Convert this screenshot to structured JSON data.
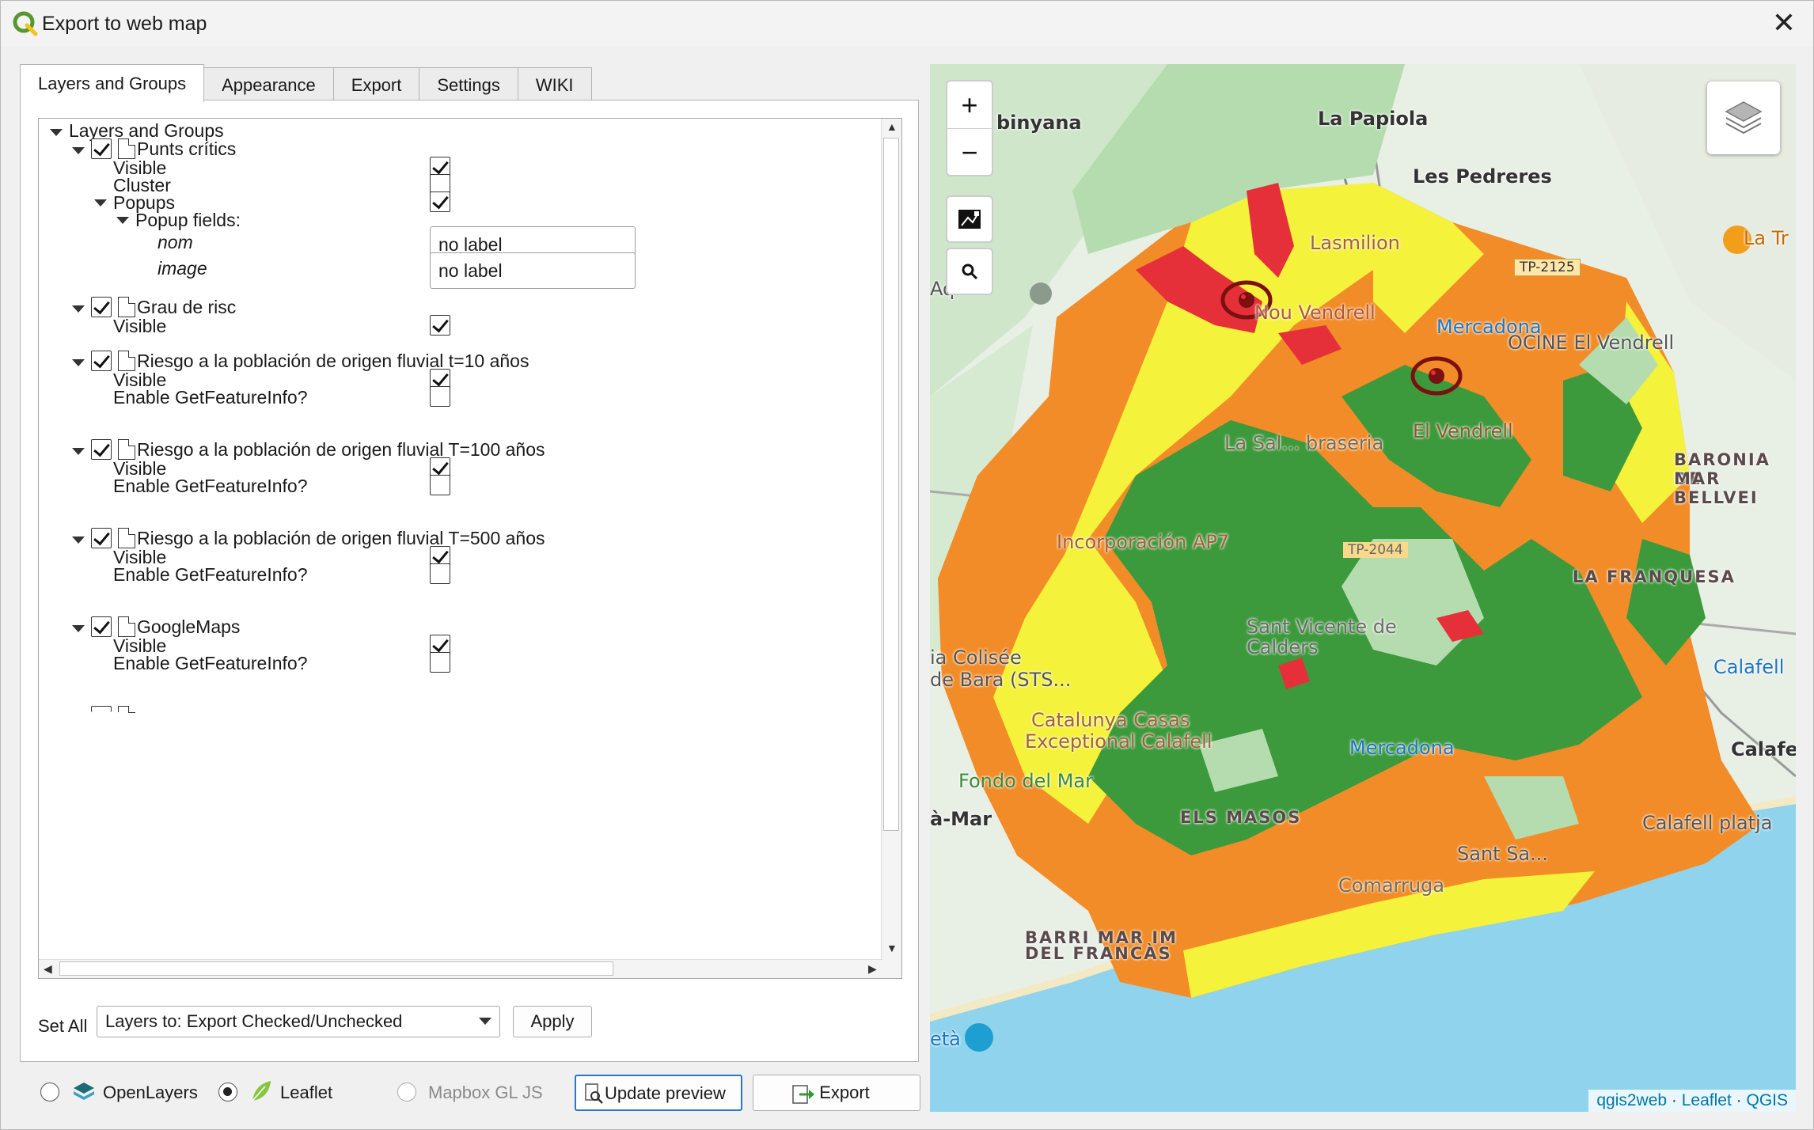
{
  "window": {
    "title": "Export to web map",
    "close_label": "✕"
  },
  "tabs": [
    {
      "label": "Layers and Groups",
      "active": true
    },
    {
      "label": "Appearance"
    },
    {
      "label": "Export"
    },
    {
      "label": "Settings"
    },
    {
      "label": "WIKI"
    }
  ],
  "tree": {
    "root": "Layers and Groups",
    "layers": [
      {
        "name": "Punts crítics",
        "checked": true,
        "visible_label": "Visible",
        "visible": true,
        "cluster_label": "Cluster",
        "cluster": false,
        "popups_label": "Popups",
        "popups": true,
        "popup_fields_label": "Popup fields:",
        "fields": [
          {
            "name": "nom",
            "value": "no label"
          },
          {
            "name": "image",
            "value": "no label"
          }
        ]
      },
      {
        "name": "Grau de risc",
        "checked": true,
        "visible_label": "Visible",
        "visible": true
      },
      {
        "name": "Riesgo a la población de origen fluvial t=10 años",
        "checked": true,
        "visible_label": "Visible",
        "visible": true,
        "gfi_label": "Enable GetFeatureInfo?",
        "gfi": false
      },
      {
        "name": "Riesgo a la población de origen fluvial T=100 años",
        "checked": true,
        "visible_label": "Visible",
        "visible": true,
        "gfi_label": "Enable GetFeatureInfo?",
        "gfi": false
      },
      {
        "name": "Riesgo a la población de origen fluvial T=500 años",
        "checked": true,
        "visible_label": "Visible",
        "visible": true,
        "gfi_label": "Enable GetFeatureInfo?",
        "gfi": false
      },
      {
        "name": "GoogleMaps",
        "checked": true,
        "visible_label": "Visible",
        "visible": true,
        "gfi_label": "Enable GetFeatureInfo?",
        "gfi": false
      }
    ]
  },
  "set_all": {
    "label": "Set All",
    "combo_value": "Layers to: Export Checked/Unchecked",
    "apply_label": "Apply"
  },
  "bottom": {
    "openlayers_label": "OpenLayers",
    "leaflet_label": "Leaflet",
    "mapbox_label": "Mapbox GL JS",
    "selected": "Leaflet",
    "update_preview_label": "Update preview",
    "export_label": "Export"
  },
  "map": {
    "zoom_in": "+",
    "zoom_out": "−",
    "attribution": {
      "qgis2web": "qgis2web",
      "sep": " · ",
      "leaflet": "Leaflet",
      "qgis": "QGIS"
    },
    "labels": [
      "binyana",
      "La Papiola",
      "Les Pedreres",
      "La Tr",
      "Aq",
      "Nou Vendrell",
      "Mercadona",
      "OCINE El Vendrell",
      "El Vendrell",
      "La Sal... braseria",
      "BARONIA DE",
      "MAR BELLVEI",
      "Incorporación AP7",
      "LA FRANQUESA",
      "Sant Vicente de Calders",
      "Calafell",
      "ia Colisée",
      "de Bara (STS...",
      "Catalunya Casas",
      "Exceptional Calafell",
      "Mercadona",
      "Calafe",
      "Fondo del Mar",
      "à-Mar",
      "ELS MASOS",
      "Sant Sa...",
      "Comarruga",
      "BARRI MAR IM",
      "DEL FRANCÀS",
      "Calafell platja",
      "età",
      "Lasmilion",
      "TP-2125",
      "TP-2044"
    ],
    "colors": {
      "high": "#e5303a",
      "medium_high": "#f28c28",
      "medium": "#f4f23a",
      "low": "#3c9a3c",
      "very_low": "#b5dcae",
      "sea": "#8fd3ec"
    }
  }
}
